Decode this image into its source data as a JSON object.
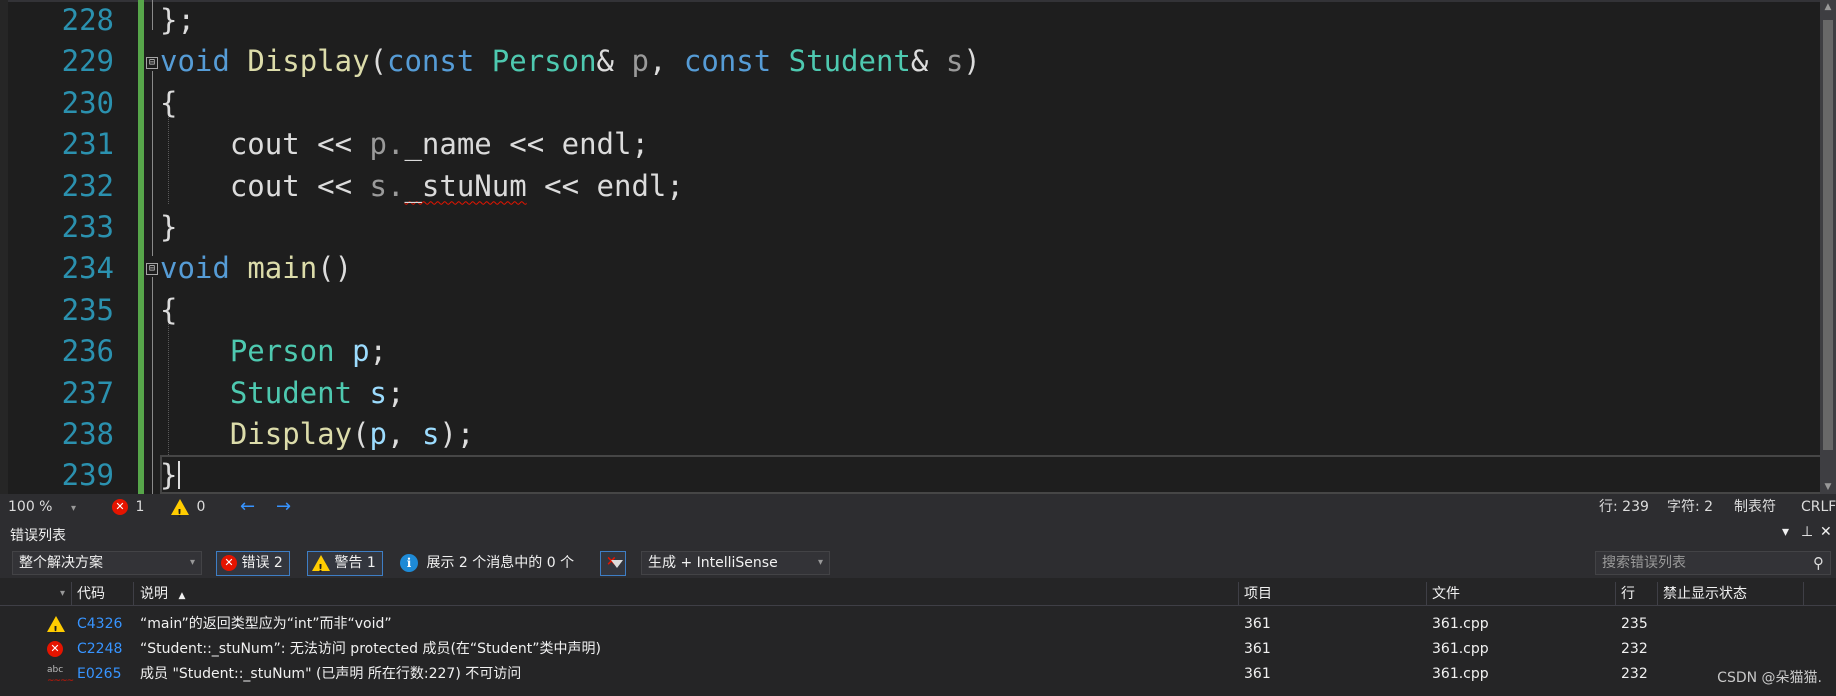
{
  "editor": {
    "line_numbers": [
      "228",
      "229",
      "230",
      "231",
      "232",
      "233",
      "234",
      "235",
      "236",
      "237",
      "238",
      "239"
    ],
    "code": {
      "l228": "};",
      "l229": {
        "kw1": "void",
        "fn": "Display",
        "open": "(",
        "kw2": "const",
        "ty1": "Person",
        "amp1": "&",
        "p": "p",
        "comma": ",",
        "kw3": "const",
        "ty2": "Student",
        "amp2": "&",
        "s": "s",
        "close": ")"
      },
      "l230": "{",
      "l231": {
        "cout": "cout",
        "op1": "<<",
        "var": "p.",
        "member": "_name",
        "op2": "<<",
        "endl": "endl",
        "semi": ";"
      },
      "l232": {
        "cout": "cout",
        "op1": "<<",
        "var": "s.",
        "member": "_stuNum",
        "op2": "<<",
        "endl": "endl",
        "semi": ";"
      },
      "l233": "}",
      "l234": {
        "kw": "void",
        "fn": "main",
        "parens": "()"
      },
      "l235": "{",
      "l236": {
        "ty": "Person",
        "var": "p",
        "semi": ";"
      },
      "l237": {
        "ty": "Student",
        "var": "s",
        "semi": ";"
      },
      "l238": {
        "fn": "Display",
        "open": "(",
        "a1": "p",
        "comma": ",",
        "a2": "s",
        "close": ")",
        "semi": ";"
      },
      "l239": "}"
    },
    "fold_glyph": "⊟"
  },
  "status_bar": {
    "zoom": "100 %",
    "zoom_caret": "▾",
    "error_count": "1",
    "warning_count": "0",
    "error_glyph": "✕",
    "back_arrow": "←",
    "forward_arrow": "→",
    "line": "行: 239",
    "char": "字符: 2",
    "indent": "制表符",
    "eol": "CRLF"
  },
  "error_list": {
    "title": "错误列表",
    "title_buttons": [
      "▾",
      "⊥",
      "✕"
    ],
    "scope": "整个解决方案",
    "errors_btn": "错误 2",
    "warnings_btn": "警告 1",
    "info_glyph": "i",
    "messages_text": "展示 2 个消息中的 0 个",
    "build_source": "生成 + IntelliSense",
    "search_placeholder": "搜索错误列表",
    "search_glyph": "⚲",
    "columns": {
      "code": "代码",
      "description": "说明",
      "sort_glyph": "▲",
      "project": "项目",
      "file": "文件",
      "line": "行",
      "suppression": "禁止显示状态"
    },
    "rows": [
      {
        "severity": "warning",
        "code": "C4326",
        "description": "“main”的返回类型应为“int”而非“void”",
        "project": "361",
        "file": "361.cpp",
        "line": "235"
      },
      {
        "severity": "error",
        "code": "C2248",
        "description": "“Student::_stuNum”: 无法访问 protected 成员(在“Student”类中声明)",
        "project": "361",
        "file": "361.cpp",
        "line": "232"
      },
      {
        "severity": "intellisense",
        "code": "E0265",
        "description": "成员 \"Student::_stuNum\" (已声明 所在行数:227) 不可访问",
        "project": "361",
        "file": "361.cpp",
        "line": "232"
      }
    ],
    "abc_label": "abc",
    "abc_wave": "~~~~"
  },
  "watermark": "CSDN @朵猫猫.",
  "colors": {
    "keyword": "#569cd6",
    "type": "#4ec9b0",
    "function": "#dcdcaa",
    "line_number": "#2b91af",
    "error": "#e51400",
    "warning": "#ffcc00",
    "link": "#3794ff",
    "change_bar": "#57a64a"
  }
}
